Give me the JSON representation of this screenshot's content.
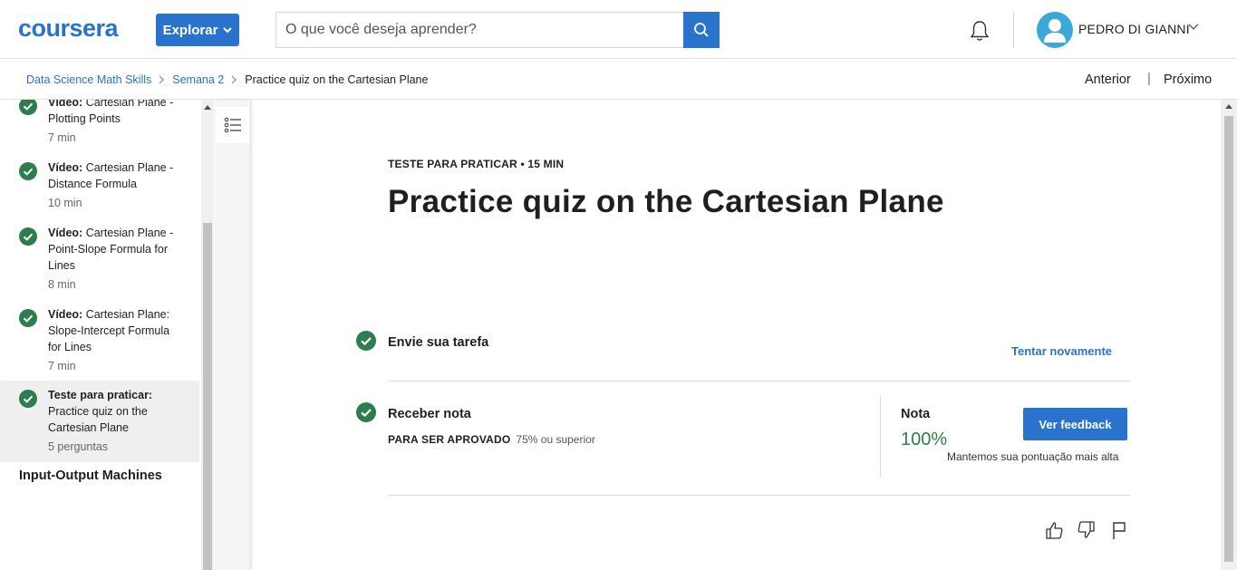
{
  "header": {
    "logo_text": "coursera",
    "explore_label": "Explorar",
    "search_placeholder": "O que você deseja aprender?",
    "user_name": "PEDRO DI GIANNI",
    "icons": [
      "search-icon",
      "bell-icon",
      "user-avatar-icon",
      "chevron-down-icon"
    ],
    "brand_color": "#2A73CC"
  },
  "breadcrumb": {
    "items": [
      "Data Science Math Skills",
      "Semana 2",
      "Practice quiz on the Cartesian Plane"
    ],
    "prev_label": "Anterior",
    "separator": "|",
    "next_label": "Próximo"
  },
  "sidebar": {
    "items": [
      {
        "type": "Vídeo:",
        "title": "Cartesian Plane - Plotting Points",
        "meta": "7 min",
        "done": true
      },
      {
        "type": "Vídeo:",
        "title": "Cartesian Plane - Distance Formula",
        "meta": "10 min",
        "done": true
      },
      {
        "type": "Vídeo:",
        "title": "Cartesian Plane - Point-Slope Formula for Lines",
        "meta": "8 min",
        "done": true
      },
      {
        "type": "Vídeo:",
        "title": "Cartesian Plane: Slope-Intercept Formula for Lines",
        "meta": "7 min",
        "done": true
      },
      {
        "type": "Teste para praticar:",
        "title": "Practice quiz on the Cartesian Plane",
        "meta": "5 perguntas",
        "done": true,
        "active": true
      }
    ],
    "next_module": "Input-Output Machines",
    "check_color": "#2E7D4F"
  },
  "main": {
    "kicker": "TESTE PARA PRATICAR • 15 MIN",
    "title": "Practice quiz on the Cartesian Plane",
    "submit": {
      "title": "Envie sua tarefa",
      "retry_label": "Tentar novamente"
    },
    "grade": {
      "title": "Receber nota",
      "pass_label": "PARA SER APROVADO",
      "pass_value": "75% ou superior",
      "grade_label": "Nota",
      "grade_value": "100%",
      "feedback_label": "Ver feedback",
      "keep_note": "Mantemos sua pontuação mais alta"
    },
    "reactions": [
      "thumbs-up-icon",
      "thumbs-down-icon",
      "flag-icon"
    ]
  }
}
